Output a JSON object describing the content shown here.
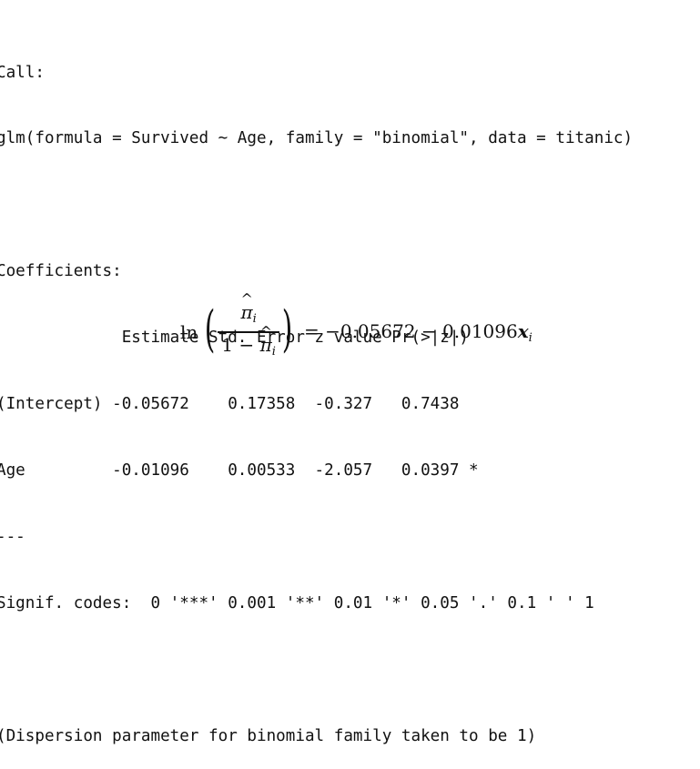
{
  "console_lines": [
    "Call:",
    "glm(formula = Survived ~ Age, family = \"binomial\", data = titanic)",
    "",
    "Coefficients:",
    "             Estimate Std. Error z value Pr(>|z|)",
    "(Intercept) -0.05672    0.17358  -0.327   0.7438",
    "Age         -0.01096    0.00533  -2.057   0.0397 *",
    "---",
    "Signif. codes:  0 '***' 0.001 '**' 0.01 '*' 0.05 '.' 0.1 ' ' 1",
    "",
    "(Dispersion parameter for binomial family taken to be 1)"
  ],
  "equation": {
    "ln": "ln",
    "left_paren": "(",
    "right_paren": ")",
    "numerator_symbol": "π",
    "numerator_sub": "i",
    "denominator_prefix": "1 − ",
    "denominator_symbol": "π",
    "denominator_sub": "i",
    "hat": "^",
    "equals": "=",
    "rhs_constant": "−0.05672 − 0.01096",
    "rhs_variable": "x",
    "rhs_sub": "i"
  }
}
